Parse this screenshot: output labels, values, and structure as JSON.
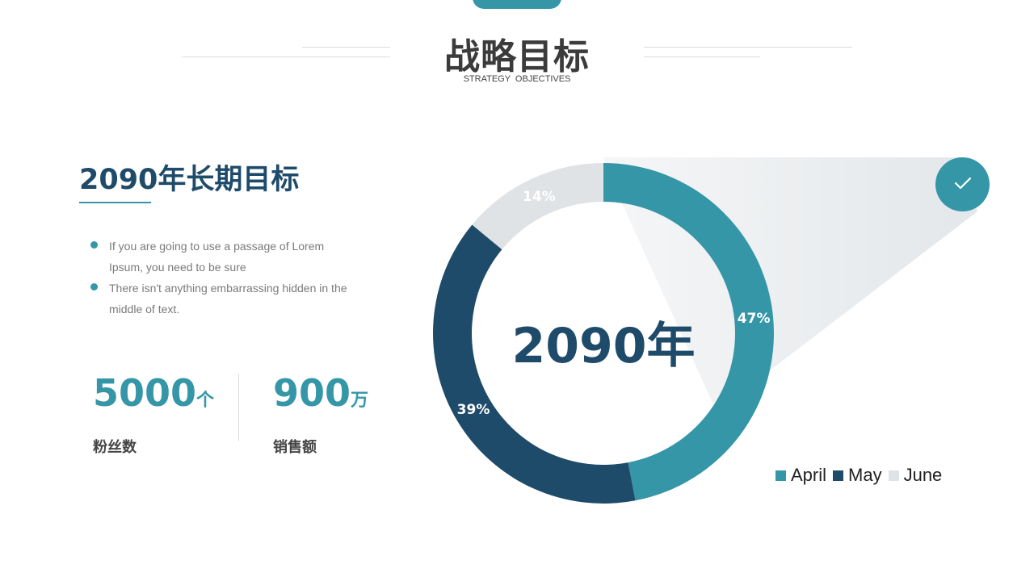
{
  "header": {
    "title": "战略目标",
    "subtitle": "STRATEGY OBJECTIVES"
  },
  "goal": {
    "heading": "2090年长期目标",
    "bullets": [
      "If you are going to use a passage of Lorem Ipsum, you need to be sure",
      "There isn't anything embarrassing hidden in the middle of text."
    ]
  },
  "stats": [
    {
      "value": "5000",
      "unit": "个",
      "label": "粉丝数"
    },
    {
      "value": "900",
      "unit": "万",
      "label": "销售额"
    }
  ],
  "colors": {
    "accent": "#3596a8",
    "dark": "#1f4b6a",
    "light": "#dfe3e6"
  },
  "icons": {
    "badge": "check-icon"
  },
  "chart_data": {
    "type": "pie",
    "center_label": "2090年",
    "categories": [
      "April",
      "May",
      "June"
    ],
    "values": [
      47,
      39,
      14
    ],
    "value_labels": [
      "47%",
      "39%",
      "14%"
    ],
    "colors": [
      "#3596a8",
      "#1f4b6a",
      "#dfe3e6"
    ],
    "legend": "bottom-right"
  }
}
